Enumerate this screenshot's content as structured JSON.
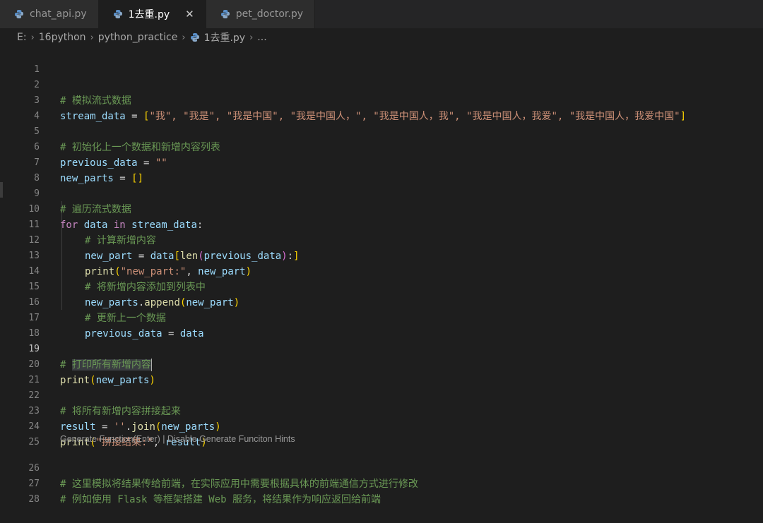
{
  "tabs": [
    {
      "label": "chat_api.py",
      "active": false
    },
    {
      "label": "1去重.py",
      "active": true
    },
    {
      "label": "pet_doctor.py",
      "active": false
    }
  ],
  "breadcrumb": [
    "E:",
    "16python",
    "python_practice",
    "1去重.py",
    "..."
  ],
  "editor": {
    "line_numbers": [
      "1",
      "2",
      "3",
      "4",
      "5",
      "6",
      "7",
      "8",
      "9",
      "10",
      "11",
      "12",
      "13",
      "14",
      "15",
      "16",
      "17",
      "18",
      "19",
      "20",
      "21",
      "22",
      "23",
      "24",
      "25",
      "26",
      "27",
      "28"
    ],
    "current_line": "19",
    "comments": {
      "l2": "# 模拟流式数据",
      "l5": "# 初始化上一个数据和新增内容列表",
      "l9": "# 遍历流式数据",
      "l11": "# 计算新增内容",
      "l14": "# 将新增内容添加到列表中",
      "l16": "# 更新上一个数据",
      "l19_hash": "# ",
      "l19_sel": "打印所有新增内容",
      "l22": "# 将所有新增内容拼接起来",
      "l26": "# 这里模拟将结果传给前端，在实际应用中需要根据具体的前端通信方式进行修改",
      "l27": "# 例如使用 Flask 等框架搭建 Web 服务，将结果作为响应返回给前端"
    },
    "l3": {
      "var": "stream_data",
      "op": " = ",
      "open": "[",
      "items": "\"我\", \"我是\", \"我是中国\", \"我是中国人，\", \"我是中国人，我\", \"我是中国人，我爱\", \"我是中国人，我爱中国\"",
      "close": "]"
    },
    "l6": {
      "var": "previous_data",
      "op": " = ",
      "str": "\"\""
    },
    "l7": {
      "var": "new_parts",
      "op": " = ",
      "br": "[]"
    },
    "l10": {
      "kw1": "for",
      "var1": " data ",
      "kw2": "in",
      "var2": " stream_data",
      "colon": ":"
    },
    "l12": {
      "var": "new_part",
      "op": " = ",
      "var2": "data",
      "open": "[",
      "fn": "len",
      "p1": "(",
      "arg": "previous_data",
      "p2": ")",
      "colon": ":",
      "close": "]"
    },
    "l13": {
      "fn": "print",
      "open": "(",
      "str": "\"new_part:\"",
      "rest": ", ",
      "var": "new_part",
      "close": ")"
    },
    "l15": {
      "var": "new_parts",
      "dot": ".",
      "fn": "append",
      "open": "(",
      "arg": "new_part",
      "close": ")"
    },
    "l17": {
      "var": "previous_data",
      "op": " = ",
      "var2": "data"
    },
    "l20": {
      "fn": "print",
      "open": "(",
      "arg": "new_parts",
      "close": ")"
    },
    "l23": {
      "var": "result",
      "op": " = ",
      "str": "''",
      "dot": ".",
      "fn": "join",
      "open": "(",
      "arg": "new_parts",
      "close": ")"
    },
    "l24": {
      "fn": "print",
      "open": "(",
      "str": "\"拼接结果:\"",
      "rest": ", ",
      "var": "result",
      "close": ")"
    },
    "hint": "Generate Function(Enter) | Disable Generate Funciton Hints"
  },
  "colors": {
    "background": "#1e1e1e",
    "comment": "#6a9955",
    "string": "#ce9178",
    "keyword": "#c586c0",
    "function": "#dcdcaa",
    "variable": "#9cdcfe"
  }
}
